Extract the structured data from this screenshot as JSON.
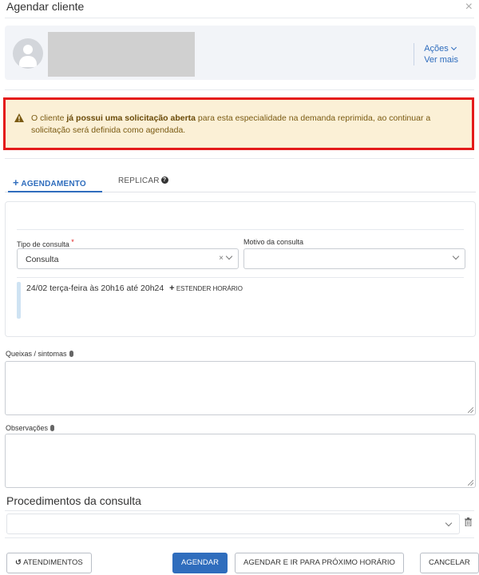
{
  "modal": {
    "title": "Agendar cliente",
    "close_icon": "×"
  },
  "client_card": {
    "actions_label": "Ações",
    "see_more_label": "Ver mais"
  },
  "alert": {
    "text_before": "O cliente ",
    "text_bold": "já possui uma solicitação aberta",
    "text_after": " para esta especialidade na demanda reprimida, ao continuar a solicitação será definida como agendada.",
    "icon": "warning-icon",
    "outline_color": "#e41b1b",
    "background_color": "#fbf0d6"
  },
  "tabs": [
    {
      "label": "AGENDAMENTO",
      "prefix": "+",
      "active": true
    },
    {
      "label": "REPLICAR",
      "help_icon": "?"
    }
  ],
  "form": {
    "tipo_consulta_label": "Tipo de consulta",
    "tipo_consulta_required": "*",
    "tipo_consulta_value": "Consulta",
    "clear_icon": "×",
    "motivo_label": "Motivo da consulta",
    "motivo_value": "",
    "time_text": "24/02 terça-feira às 20h16 até 20h24",
    "extend_prefix": "+",
    "extend_label": "ESTENDER HORÁRIO"
  },
  "queixas_label": "Queixas / sintomas",
  "observacoes_label": "Observações",
  "procedimentos_title": "Procedimentos da consulta",
  "buttons": {
    "atendimentos_icon": "↺",
    "atendimentos": "ATENDIMENTOS",
    "agendar": "AGENDAR",
    "agendar_proximo": "AGENDAR E IR PARA PRÓXIMO HORÁRIO",
    "cancelar": "CANCELAR"
  },
  "colors": {
    "accent": "#2f6dbd",
    "required": "#e02020"
  }
}
